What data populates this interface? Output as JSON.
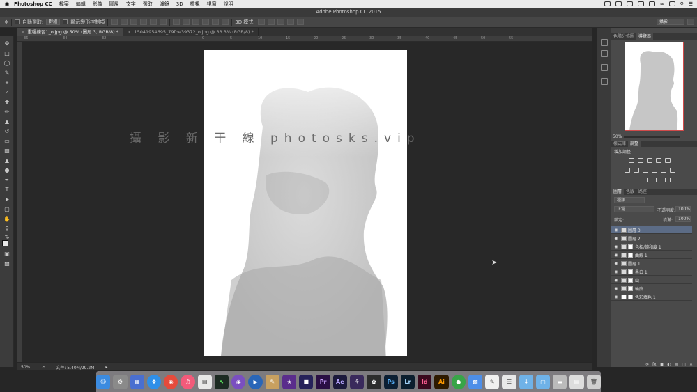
{
  "menubar": {
    "apple": "",
    "app": "Photoshop CC",
    "items": [
      "檔案",
      "編輯",
      "影像",
      "圖層",
      "文字",
      "選取",
      "濾鏡",
      "3D",
      "檢視",
      "視窗",
      "說明"
    ]
  },
  "window": {
    "title": "Adobe Photoshop CC 2015"
  },
  "options": {
    "auto_select_label": "自動選取:",
    "auto_select_value": "群組",
    "show_transform_label": "顯示變形控制項",
    "mode_3d_label": "3D 模式:",
    "workspace": "攝影"
  },
  "tabs": [
    {
      "label": "重曝練習1_o.jpg @ 50% (圖層 3, RGB/8) *"
    },
    {
      "label": "15041954695_79fbe39372_o.jpg @ 33.3% (RGB/8) *"
    }
  ],
  "ruler": {
    "h_ticks": [
      "36",
      "34",
      "32",
      "0",
      "5",
      "10",
      "15",
      "20",
      "25",
      "30",
      "35",
      "40",
      "45",
      "50",
      "55"
    ]
  },
  "watermark": "攝 影 新 干 線   photosks.vip",
  "status": {
    "zoom": "50%",
    "doc_size": "文件: 5.40M/29.2M"
  },
  "nav_panel": {
    "tabs": [
      "色階分佈圖",
      "導覽器"
    ],
    "zoom": "50%"
  },
  "adj_panel": {
    "tabs": [
      "樣式庫",
      "調整"
    ],
    "title": "增加調整"
  },
  "layers_panel": {
    "tabs": [
      "圖層",
      "色版",
      "路徑"
    ],
    "filter": "種類",
    "blend_mode": "正常",
    "opacity_label": "不透明度:",
    "opacity": "100%",
    "lock_label": "鎖定:",
    "fill_label": "填滿:",
    "fill": "100%",
    "layers": [
      {
        "name": "圖層 3"
      },
      {
        "name": "圖層 2"
      },
      {
        "name": "色相/飽和度 1"
      },
      {
        "name": "曲線 1"
      },
      {
        "name": "圖層 1"
      },
      {
        "name": "黑白 1"
      },
      {
        "name": "山"
      },
      {
        "name": "輪廓"
      },
      {
        "name": "色彩填色 1"
      }
    ]
  },
  "dock": {
    "items": [
      "Pr",
      "Ae",
      "Ps",
      "Lr",
      "Id",
      "Ai"
    ]
  }
}
